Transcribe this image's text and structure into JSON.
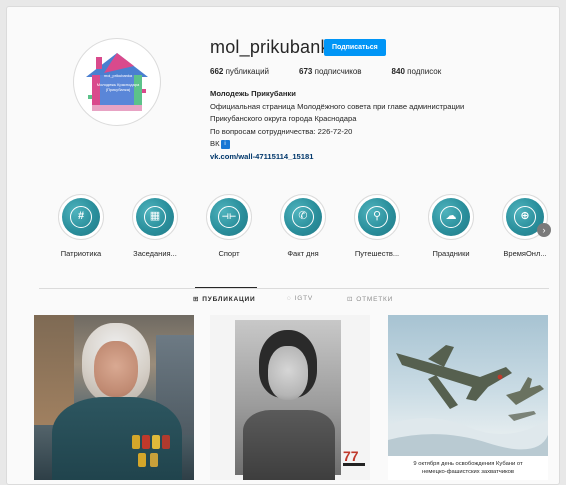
{
  "profile": {
    "username": "mol_prikubanka",
    "follow_label": "Подписаться",
    "avatar": {
      "line1": "mol_prikubanka",
      "line2": "Молодежь Краснодара",
      "line3": "(Прикубанка)"
    },
    "stats": {
      "posts_count": "662",
      "posts_label": "публикаций",
      "followers_count": "673",
      "followers_label": "подписчиков",
      "following_count": "840",
      "following_label": "подписок"
    },
    "bio": {
      "name": "Молодежь Прикубанки",
      "line1": "Официальная страница Молодёжного совета при главе администрации",
      "line2": "Прикубанского округа города Краснодара",
      "line3": "По вопросам сотрудничества: 226-72-20",
      "line4": "ВК",
      "link": "vk.com/wall-47115114_15181"
    }
  },
  "highlights": [
    {
      "label": "Патриотика",
      "icon": "hashtag-icon",
      "glyph": "#"
    },
    {
      "label": "Заседания...",
      "icon": "presentation-icon",
      "glyph": "▦"
    },
    {
      "label": "Спорт",
      "icon": "dumbbell-icon",
      "glyph": "⊣⊢"
    },
    {
      "label": "Факт дня",
      "icon": "phone-icon",
      "glyph": "✆"
    },
    {
      "label": "Путешеств...",
      "icon": "location-pin-icon",
      "glyph": "⚲"
    },
    {
      "label": "Праздники",
      "icon": "balloon-icon",
      "glyph": "☁"
    },
    {
      "label": "ВремяОнл...",
      "icon": "globe-icon",
      "glyph": "⊕"
    }
  ],
  "tabs": [
    {
      "label": "ПУБЛИКАЦИИ",
      "icon": "grid-icon",
      "glyph": "⊞",
      "active": true
    },
    {
      "label": "IGTV",
      "icon": "igtv-icon",
      "glyph": "◌",
      "active": false
    },
    {
      "label": "ОТМЕТКИ",
      "icon": "tag-icon",
      "glyph": "⊡",
      "active": false
    }
  ],
  "posts": [
    {
      "caption": ""
    },
    {
      "caption": "",
      "badge": "77"
    },
    {
      "caption_line1": "9 октября день освобождения Кубани от",
      "caption_line2": "немецко-фашистских захватчиков"
    }
  ],
  "colors": {
    "accent": "#0095f6",
    "highlight_teal": "#2a8f9c",
    "house_pink": "#d94a8c",
    "house_blue": "#4a7fd0",
    "house_green": "#5cc28a"
  }
}
